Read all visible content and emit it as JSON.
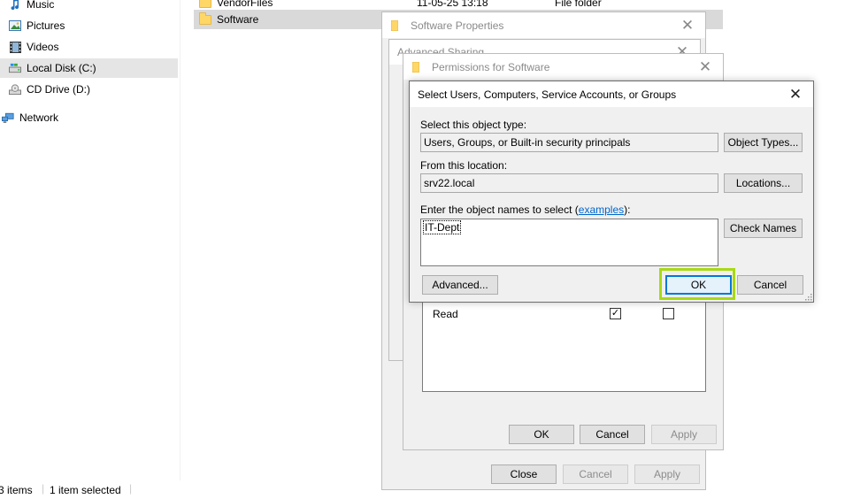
{
  "nav": {
    "items": [
      {
        "label": "Music",
        "icon": "music-icon"
      },
      {
        "label": "Pictures",
        "icon": "pictures-icon"
      },
      {
        "label": "Videos",
        "icon": "videos-icon"
      },
      {
        "label": "Local Disk (C:)",
        "icon": "drive-icon"
      },
      {
        "label": "CD Drive (D:)",
        "icon": "cd-drive-icon"
      },
      {
        "label": "Network",
        "icon": "network-icon"
      }
    ]
  },
  "files": {
    "rows": [
      {
        "name": "VendorFiles",
        "date": "11-05-25 13:18",
        "type": "File folder"
      },
      {
        "name": "Software",
        "date": "",
        "type": ""
      }
    ]
  },
  "status": {
    "items_count": "3 items",
    "selected": "1 item selected"
  },
  "props_dialog": {
    "title": "Software Properties",
    "close_label": "Close",
    "cancel_label": "Cancel",
    "apply_label": "Apply"
  },
  "adv_sharing_dialog": {
    "title": "Advanced Sharing"
  },
  "perm_dialog": {
    "title": "Permissions for Software",
    "row_label": "Read",
    "ok_label": "OK",
    "cancel_label": "Cancel",
    "apply_label": "Apply"
  },
  "select_dialog": {
    "title": "Select Users, Computers, Service Accounts, or Groups",
    "object_type_label": "Select this object type:",
    "object_type_value": "Users, Groups, or Built-in security principals",
    "object_types_button": "Object Types...",
    "location_label": "From this location:",
    "location_value": "srv22.local",
    "locations_button": "Locations...",
    "names_label_prefix": "Enter the object names to select (",
    "names_label_link": "examples",
    "names_label_suffix": "):",
    "names_value": "IT-Dept",
    "check_names_button": "Check Names",
    "advanced_button": "Advanced...",
    "ok_button": "OK",
    "cancel_button": "Cancel"
  },
  "colors": {
    "highlight": "#a8d915",
    "accent": "#0078d7",
    "link": "#0066cc"
  }
}
